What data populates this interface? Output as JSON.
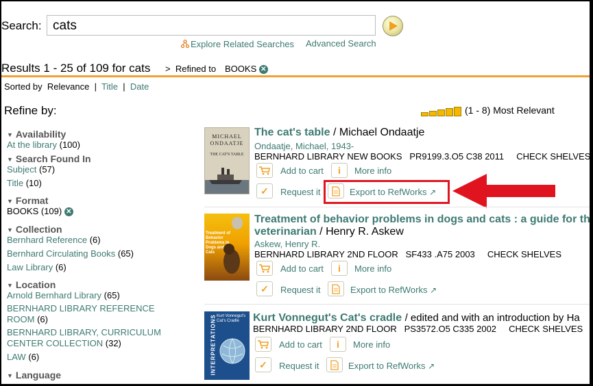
{
  "search": {
    "label": "Search:",
    "value": "cats"
  },
  "links": {
    "explore": "Explore Related Searches",
    "advanced": "Advanced Search"
  },
  "results": {
    "summary": "Results 1 - 25 of 109 for cats",
    "arrow": ">",
    "refined_label": "Refined to",
    "refined_value": "BOOKS"
  },
  "sort": {
    "label": "Sorted by",
    "relevance": "Relevance",
    "title": "Title",
    "date": "Date",
    "divider": "|"
  },
  "refine_by": "Refine by:",
  "relevance_label": "(1 - 8) Most Relevant",
  "facets": {
    "availability": {
      "heading": "Availability",
      "items": [
        {
          "label": "At the library",
          "count": "(100)"
        }
      ]
    },
    "search_found_in": {
      "heading": "Search Found In",
      "items": [
        {
          "label": "Subject",
          "count": "(57)"
        },
        {
          "label": "Title",
          "count": "(10)"
        }
      ]
    },
    "format": {
      "heading": "Format",
      "items": [
        {
          "label": "BOOKS",
          "count": "(109)"
        }
      ]
    },
    "collection": {
      "heading": "Collection",
      "items": [
        {
          "label": "Bernhard Reference",
          "count": "(6)"
        },
        {
          "label": "Bernhard Circulating Books",
          "count": "(65)"
        },
        {
          "label": "Law Library",
          "count": "(6)"
        }
      ]
    },
    "location": {
      "heading": "Location",
      "items": [
        {
          "label": "Arnold Bernhard Library",
          "count": "(65)"
        },
        {
          "label_line1": "BERNHARD LIBRARY REFERENCE",
          "label_line2": "ROOM",
          "count": "(6)"
        },
        {
          "label_line1": "BERNHARD LIBRARY, CURRICULUM",
          "label_line2": "CENTER COLLECTION",
          "count": "(32)"
        },
        {
          "label": "LAW",
          "count": "(6)"
        }
      ]
    },
    "language": {
      "heading": "Language"
    }
  },
  "actions": {
    "add_to_cart": "Add to cart",
    "more_info": "More info",
    "request_it": "Request it",
    "export": "Export to RefWorks"
  },
  "records": [
    {
      "title": "The cat's table",
      "responsibility": "/ Michael Ondaatje",
      "author": "Ondaatje, Michael, 1943-",
      "location": "BERNHARD LIBRARY NEW BOOKS",
      "call_number": "PR9199.3.O5 C38 2011",
      "status": "CHECK SHELVES",
      "cover_author": "MICHAEL ONDAATJE",
      "cover_title": "THE CAT'S TABLE"
    },
    {
      "title_line1": "Treatment of behavior problems in dogs and cats : a guide for the",
      "title_line2": "veterinarian",
      "responsibility": "/ Henry R. Askew",
      "author": "Askew, Henry R.",
      "location": "BERNHARD LIBRARY 2ND FLOOR",
      "call_number": "SF433 .A75 2003",
      "status": "CHECK SHELVES",
      "cover_title": "Treatment of Behavior Problems in Dogs and Cats"
    },
    {
      "title": "Kurt Vonnegut's Cat's cradle",
      "responsibility": "/ edited and with an introduction by Ha",
      "location": "BERNHARD LIBRARY 2ND FLOOR",
      "call_number": "PS3572.O5 C335 2002",
      "status": "CHECK SHELVES",
      "cover_series": "INTERPRETATIONS",
      "cover_title": "Kurt Vonnegut's Cat's Cradle"
    }
  ],
  "colors": {
    "accent": "#f0a030",
    "link": "#3d7a72",
    "highlight": "#e0141e"
  }
}
